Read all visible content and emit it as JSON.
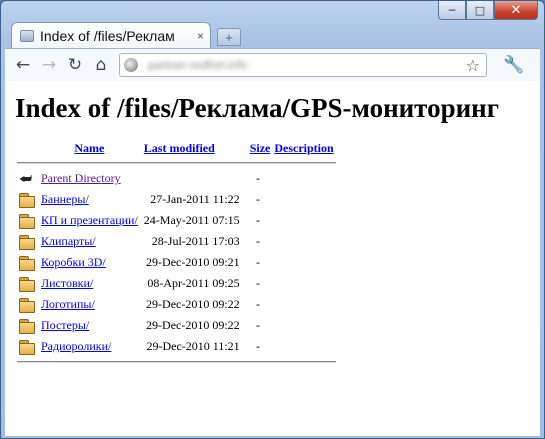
{
  "window": {
    "minimize_glyph": "─",
    "maximize_glyph": "□",
    "close_glyph": "✕"
  },
  "tab": {
    "title": "Index of /files/Реклам",
    "close_glyph": "×",
    "newtab_glyph": "+"
  },
  "toolbar": {
    "back_glyph": "←",
    "forward_glyph": "→",
    "reload_glyph": "↻",
    "home_glyph": "⌂",
    "url": "partner-redfort.info",
    "star_glyph": "☆",
    "wrench_glyph": "🔧"
  },
  "page": {
    "heading": "Index of /files/Реклама/GPS-мониторинг",
    "columns": {
      "name": "Name",
      "last_modified": "Last modified",
      "size": "Size",
      "description": "Description"
    },
    "parent": {
      "name": "Parent Directory",
      "size": "-"
    },
    "entries": [
      {
        "name": "Баннеры/",
        "date": "27-Jan-2011 11:22",
        "size": "-"
      },
      {
        "name": "КП и презентации/",
        "date": "24-May-2011 07:15",
        "size": "-"
      },
      {
        "name": "Клипарты/",
        "date": "28-Jul-2011 17:03",
        "size": "-"
      },
      {
        "name": "Коробки 3D/",
        "date": "29-Dec-2010 09:21",
        "size": "-"
      },
      {
        "name": "Листовки/",
        "date": "08-Apr-2011 09:25",
        "size": "-"
      },
      {
        "name": "Логотипы/",
        "date": "29-Dec-2010 09:22",
        "size": "-"
      },
      {
        "name": "Постеры/",
        "date": "29-Dec-2010 09:22",
        "size": "-"
      },
      {
        "name": "Радиоролики/",
        "date": "29-Dec-2010 11:21",
        "size": "-"
      }
    ]
  }
}
